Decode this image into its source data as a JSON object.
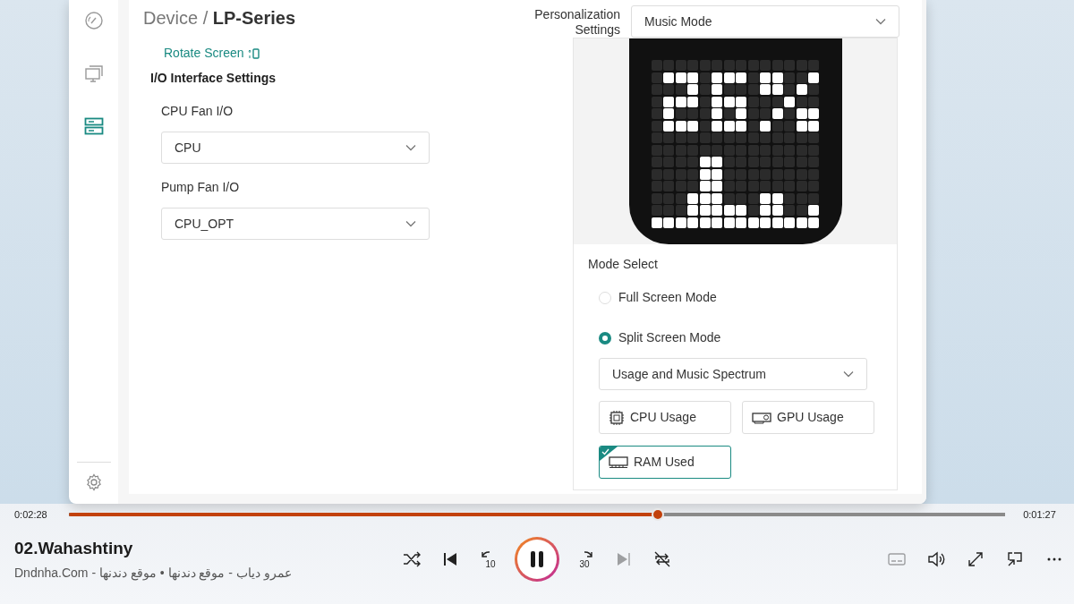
{
  "sidebar": {
    "items": [
      {
        "kind": "dashboard",
        "selected": false
      },
      {
        "kind": "monitor",
        "selected": false
      },
      {
        "kind": "devices",
        "selected": true
      }
    ],
    "footer": {
      "kind": "settings"
    }
  },
  "breadcrumb": {
    "parent": "Device",
    "separator": "/",
    "current": "LP-Series"
  },
  "rotate_link": "Rotate Screen",
  "io_section": {
    "title": "I/O Interface Settings",
    "fields": [
      {
        "label": "CPU Fan I/O",
        "value": "CPU"
      },
      {
        "label": "Pump Fan I/O",
        "value": "CPU_OPT"
      }
    ]
  },
  "personalization": {
    "label": "Personalization Settings",
    "value": "Music Mode"
  },
  "mode_select": {
    "label": "Mode Select",
    "options": [
      {
        "label": "Full Screen Mode",
        "selected": false
      },
      {
        "label": "Split Screen Mode",
        "selected": true
      }
    ],
    "split_value": "Usage and Music Spectrum",
    "metrics": [
      {
        "kind": "cpu",
        "label": "CPU Usage",
        "selected": false
      },
      {
        "kind": "gpu",
        "label": "GPU Usage",
        "selected": false
      },
      {
        "kind": "ram",
        "label": "RAM Used",
        "selected": true
      }
    ]
  },
  "player": {
    "elapsed": "0:02:28",
    "remaining": "0:01:27",
    "level": 0.629,
    "title": "02.Wahashtiny",
    "subtitle": "Dndnha.Com - عمرو دياب - موقع دندنها • موقع دندنها",
    "controls": [
      {
        "kind": "shuffle",
        "disabled": false
      },
      {
        "kind": "previous",
        "disabled": false
      },
      {
        "kind": "skip_back",
        "label": "10",
        "disabled": false
      },
      {
        "kind": "pause",
        "disabled": false
      },
      {
        "kind": "skip_forward",
        "label": "30",
        "disabled": false
      },
      {
        "kind": "next",
        "disabled": true
      },
      {
        "kind": "repeat",
        "disabled": false
      }
    ],
    "tools": [
      {
        "kind": "captions",
        "disabled": true
      },
      {
        "kind": "volume",
        "disabled": false
      },
      {
        "kind": "fullscreen",
        "disabled": false
      },
      {
        "kind": "miniplayer",
        "disabled": false
      },
      {
        "kind": "more",
        "disabled": false
      }
    ]
  }
}
